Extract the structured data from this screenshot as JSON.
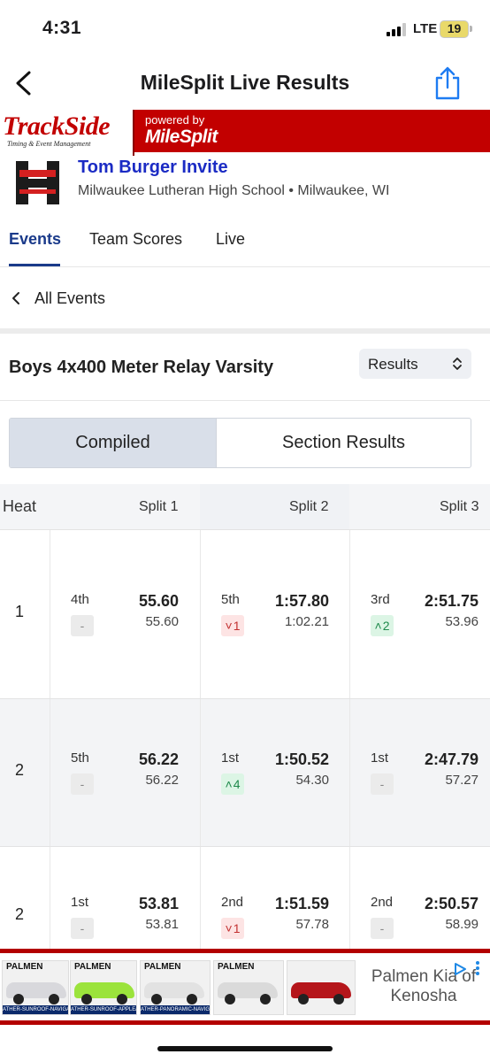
{
  "status_bar": {
    "time": "4:31",
    "network": "LTE",
    "battery": "19"
  },
  "nav": {
    "title": "MileSplit Live Results"
  },
  "banner": {
    "logo_text": "TrackSide",
    "logo_subtext": "Timing & Event Management",
    "powered_by": "powered by",
    "brand": "MileSplit"
  },
  "meet": {
    "title": "Tom Burger Invite",
    "location": "Milwaukee Lutheran High School • Milwaukee, WI"
  },
  "tabs": [
    {
      "label": "Events",
      "active": true
    },
    {
      "label": "Team Scores",
      "active": false
    },
    {
      "label": "Live",
      "active": false
    }
  ],
  "back_link": {
    "label": "All Events"
  },
  "event": {
    "title": "Boys 4x400 Meter Relay Varsity",
    "view_select": "Results"
  },
  "segments": [
    {
      "label": "Compiled",
      "active": true
    },
    {
      "label": "Section Results",
      "active": false
    }
  ],
  "table": {
    "headers": {
      "heat": "Heat",
      "split1": "Split 1",
      "split2": "Split 2",
      "split3": "Split 3"
    },
    "rows": [
      {
        "heat": "1",
        "splits": [
          {
            "place": "4th",
            "time": "55.60",
            "change": "-",
            "dir": "none",
            "lap": "55.60"
          },
          {
            "place": "5th",
            "time": "1:57.80",
            "change": "1",
            "dir": "down",
            "lap": "1:02.21"
          },
          {
            "place": "3rd",
            "time": "2:51.75",
            "change": "2",
            "dir": "up",
            "lap": "53.96"
          }
        ]
      },
      {
        "heat": "2",
        "splits": [
          {
            "place": "5th",
            "time": "56.22",
            "change": "-",
            "dir": "none",
            "lap": "56.22"
          },
          {
            "place": "1st",
            "time": "1:50.52",
            "change": "4",
            "dir": "up",
            "lap": "54.30"
          },
          {
            "place": "1st",
            "time": "2:47.79",
            "change": "-",
            "dir": "none",
            "lap": "57.27"
          }
        ]
      },
      {
        "heat": "2",
        "splits": [
          {
            "place": "1st",
            "time": "53.81",
            "change": "-",
            "dir": "none",
            "lap": "53.81"
          },
          {
            "place": "2nd",
            "time": "1:51.59",
            "change": "1",
            "dir": "down",
            "lap": "57.78"
          },
          {
            "place": "2nd",
            "time": "2:50.57",
            "change": "-",
            "dir": "none",
            "lap": "58.99"
          }
        ]
      }
    ]
  },
  "ad": {
    "cars": [
      {
        "brand": "PALMEN",
        "caption": "ATHER-SUNROOF-NAVIGATION",
        "color": "#d8d8dc"
      },
      {
        "brand": "PALMEN",
        "caption": "ATHER-SUNROOF-APPLE/ANDRO",
        "color": "#9be33c"
      },
      {
        "brand": "PALMEN",
        "caption": "ATHER-PANORAMIC-NAVIGATION",
        "color": "#e2e2e2"
      },
      {
        "brand": "PALMEN",
        "caption": "",
        "color": "#dadada"
      },
      {
        "brand": "",
        "caption": "",
        "color": "#b5161b"
      }
    ],
    "text": "Palmen Kia of Kenosha"
  }
}
